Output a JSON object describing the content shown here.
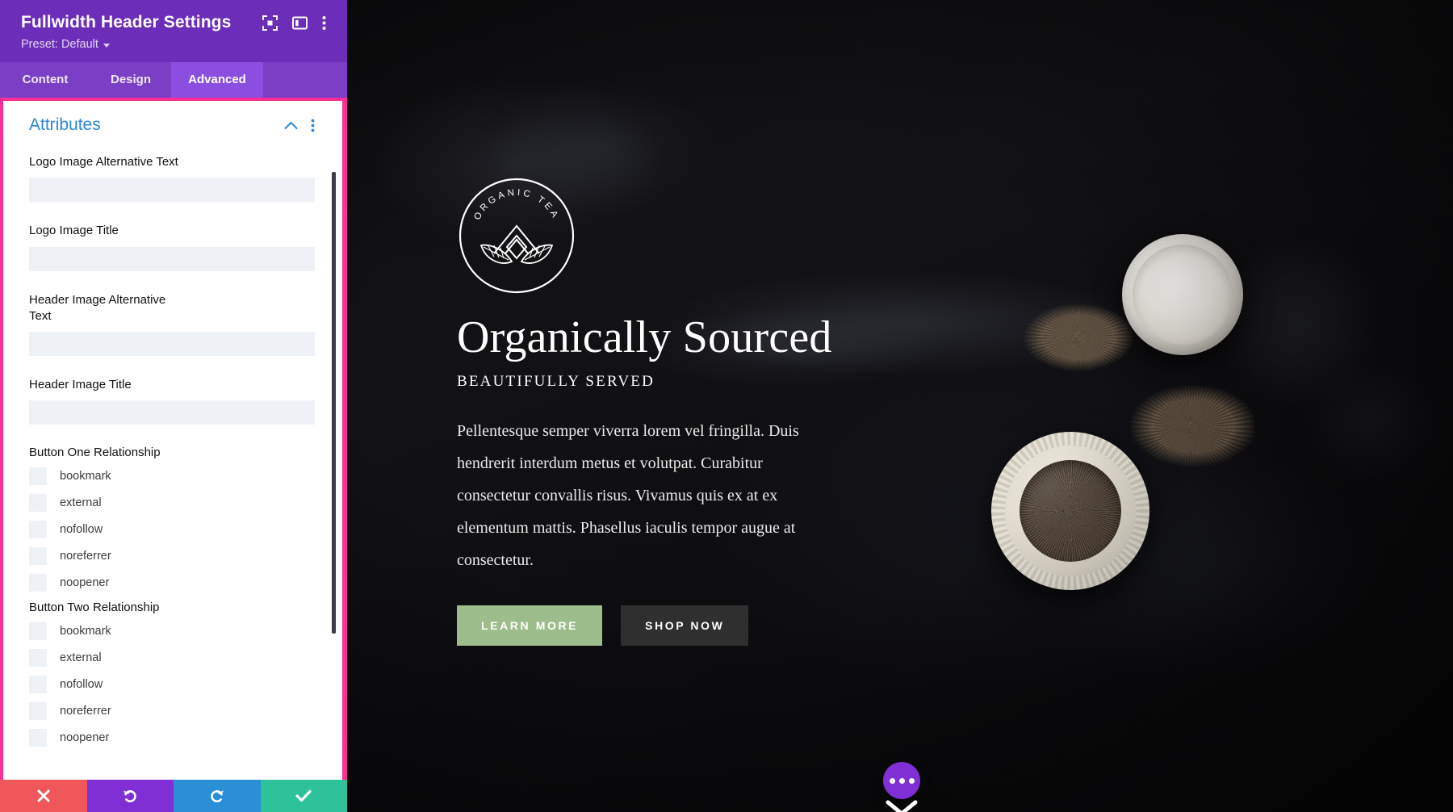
{
  "panel": {
    "title": "Fullwidth Header Settings",
    "preset_label": "Preset: Default",
    "header_icons": [
      {
        "name": "focus-target-icon"
      },
      {
        "name": "layout-panel-icon"
      },
      {
        "name": "more-vertical-icon"
      }
    ],
    "tabs": [
      {
        "label": "Content",
        "active": false
      },
      {
        "label": "Design",
        "active": false
      },
      {
        "label": "Advanced",
        "active": true
      }
    ],
    "section": {
      "title": "Attributes",
      "collapse_icon": "chevron-up-icon",
      "menu_icon": "more-vertical-icon"
    },
    "fields": [
      {
        "label": "Logo Image Alternative Text",
        "value": "",
        "placeholder": ""
      },
      {
        "label": "Logo Image Title",
        "value": "",
        "placeholder": ""
      },
      {
        "label": "Header Image Alternative Text",
        "value": "",
        "placeholder": ""
      },
      {
        "label": "Header Image Title",
        "value": "",
        "placeholder": ""
      }
    ],
    "groups": [
      {
        "label": "Button One Relationship",
        "options": [
          {
            "label": "bookmark",
            "checked": false
          },
          {
            "label": "external",
            "checked": false
          },
          {
            "label": "nofollow",
            "checked": false
          },
          {
            "label": "noreferrer",
            "checked": false
          },
          {
            "label": "noopener",
            "checked": false
          }
        ]
      },
      {
        "label": "Button Two Relationship",
        "options": [
          {
            "label": "bookmark",
            "checked": false
          },
          {
            "label": "external",
            "checked": false
          },
          {
            "label": "nofollow",
            "checked": false
          },
          {
            "label": "noreferrer",
            "checked": false
          },
          {
            "label": "noopener",
            "checked": false
          }
        ]
      }
    ],
    "footer": [
      {
        "name": "cancel-button",
        "icon": "close-icon",
        "color": "#f0575b"
      },
      {
        "name": "undo-button",
        "icon": "undo-icon",
        "color": "#7f2fd4"
      },
      {
        "name": "redo-button",
        "icon": "redo-icon",
        "color": "#2a8fd4"
      },
      {
        "name": "save-button",
        "icon": "check-icon",
        "color": "#2ec29b"
      }
    ],
    "colors": {
      "header_purple": "#6c2eb9",
      "tab_bar": "#7a3fc4",
      "tab_active": "#8b4ee0",
      "active_outline_pink": "#ff2d96",
      "section_title_blue": "#2b87da",
      "input_bg": "#eef2f7"
    }
  },
  "hero": {
    "logo": {
      "arc_text": "ORGANIC TEA",
      "name": "organic-tea-logo"
    },
    "title": "Organically Sourced",
    "subtitle": "BEAUTIFULLY SERVED",
    "body": "Pellentesque semper viverra lorem vel fringilla. Duis hendrerit interdum metus et volutpat. Curabitur consectetur convallis risus. Vivamus quis ex at ex elementum mattis. Phasellus iaculis tempor augue at consectetur.",
    "buttons": [
      {
        "label": "LEARN MORE",
        "color": "#9ebd8c"
      },
      {
        "label": "SHOP NOW",
        "color": "#2f2f2f"
      }
    ],
    "fab": {
      "name": "page-settings-fab",
      "icon": "more-horizontal-icon",
      "color": "#7f2fd4"
    },
    "scroll_indicator": {
      "name": "scroll-down-chevron-icon"
    }
  }
}
